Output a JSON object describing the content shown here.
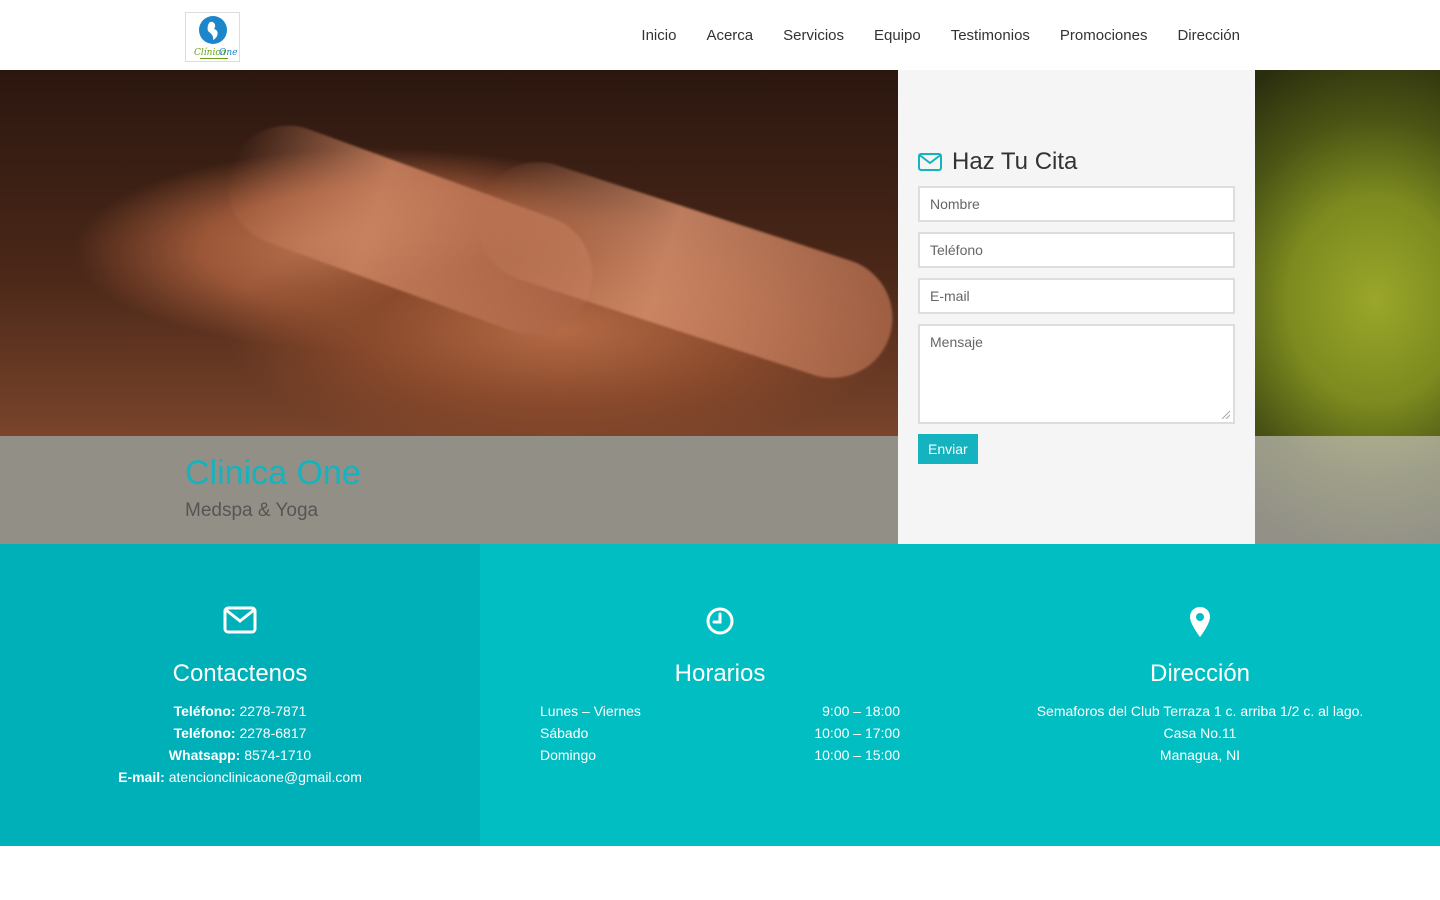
{
  "header": {
    "nav": [
      "Inicio",
      "Acerca",
      "Servicios",
      "Equipo",
      "Testimonios",
      "Promociones",
      "Dirección"
    ]
  },
  "hero": {
    "title": "Clinica One",
    "subtitle": "Medspa & Yoga"
  },
  "form": {
    "title": "Haz Tu Cita",
    "placeholders": {
      "name": "Nombre",
      "phone": "Teléfono",
      "email": "E-mail",
      "message": "Mensaje"
    },
    "submit_label": "Enviar"
  },
  "contact": {
    "title": "Contactenos",
    "phone1_label": "Teléfono:",
    "phone1": "2278-7871",
    "phone2_label": "Teléfono:",
    "phone2": "2278-6817",
    "whatsapp_label": "Whatsapp:",
    "whatsapp": "8574-1710",
    "email_label": "E-mail:",
    "email": "atencionclinicaone@gmail.com"
  },
  "hours": {
    "title": "Horarios",
    "rows": [
      {
        "day": "Lunes – Viernes",
        "time": "9:00 – 18:00"
      },
      {
        "day": "Sábado",
        "time": "10:00 – 17:00"
      },
      {
        "day": "Domingo",
        "time": "10:00 – 15:00"
      }
    ]
  },
  "address": {
    "title": "Dirección",
    "line1": "Semaforos del Club Terraza 1 c. arriba 1/2 c. al lago.",
    "line2": "Casa No.11",
    "line3": "Managua, NI"
  },
  "colors": {
    "accent": "#14b3bf",
    "strip_dark": "#00b0b8",
    "strip_light": "#00bec2"
  },
  "icons": {
    "form": "envelope-icon",
    "contact": "envelope-icon",
    "hours": "clock-icon",
    "address": "map-marker-icon"
  }
}
